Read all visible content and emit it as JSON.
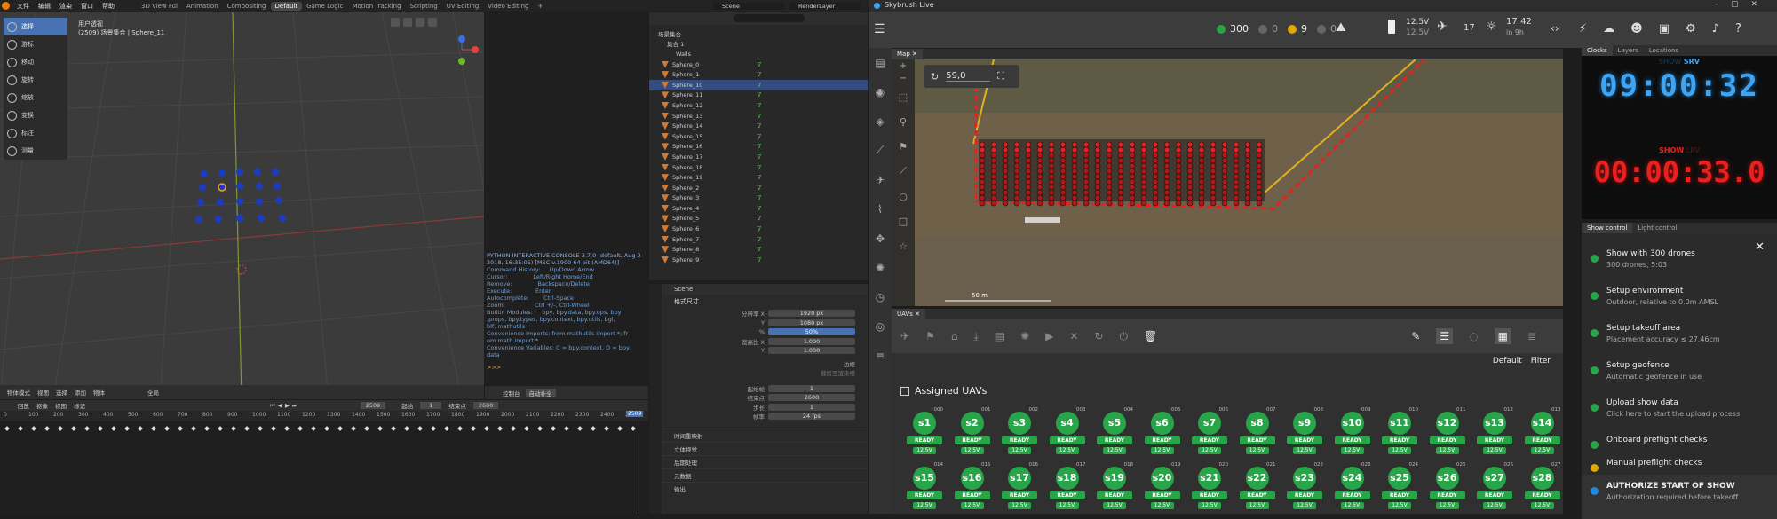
{
  "blender": {
    "menus": [
      "文件",
      "编辑",
      "渲染",
      "窗口",
      "帮助"
    ],
    "workspaces": [
      "3D View Ful",
      "Animation",
      "Compositing",
      "Default",
      "Game Logic",
      "Motion Tracking",
      "Scripting",
      "UV Editing",
      "Video Editing"
    ],
    "active_workspace": "Default",
    "scene_field": "Scene",
    "layer_field": "RenderLayer",
    "viewport": {
      "info_line1": "用户透视",
      "info_line2": "(2509) 场景集合 | Sphere_11"
    },
    "tools": [
      {
        "label": "选择",
        "icon": "cursor-icon"
      },
      {
        "label": "游标",
        "icon": "cursor-target-icon"
      },
      {
        "label": "移动",
        "icon": "move-icon"
      },
      {
        "label": "旋转",
        "icon": "rotate-icon"
      },
      {
        "label": "缩放",
        "icon": "scale-icon"
      },
      {
        "label": "变换",
        "icon": "transform-icon"
      },
      {
        "label": "标注",
        "icon": "annotate-icon"
      },
      {
        "label": "测量",
        "icon": "measure-icon"
      }
    ],
    "vp_footer": [
      "物体模式",
      "视图",
      "选择",
      "添加",
      "物体",
      "全局"
    ],
    "console": {
      "lines": [
        "PYTHON INTERACTIVE CONSOLE 3.7.0 (default, Aug 2",
        "2018, 16:35:05) [MSC v.1900 64 bit (AMD64)]",
        "",
        "Command History:     Up/Down Arrow",
        "Cursor:              Left/Right Home/End",
        "Remove:              Backspace/Delete",
        "Execute:             Enter",
        "Autocomplete:        Ctrl-Space",
        "Zoom:                Ctrl +/-, Ctrl-Wheel",
        "Builtin Modules:     bpy, bpy.data, bpy.ops, bpy",
        ".props, bpy.types, bpy.context, bpy.utils, bgl,",
        "blf, mathutils",
        "Convenience Imports: from mathutils import *; fr",
        "om math import *",
        "Convenience Variables: C = bpy.context, D = bpy.",
        "data"
      ],
      "prompt": ">>> ",
      "footer": [
        "控制台",
        "自动补全"
      ]
    },
    "outliner": {
      "scene_collection": "场景集合",
      "collection": "集合 1",
      "group": "Walls",
      "items": [
        "Sphere_0",
        "Sphere_1",
        "Sphere_10",
        "Sphere_11",
        "Sphere_12",
        "Sphere_13",
        "Sphere_14",
        "Sphere_15",
        "Sphere_16",
        "Sphere_17",
        "Sphere_18",
        "Sphere_19",
        "Sphere_2",
        "Sphere_3",
        "Sphere_4",
        "Sphere_5",
        "Sphere_6",
        "Sphere_7",
        "Sphere_8",
        "Sphere_9"
      ],
      "selected": "Sphere_10"
    },
    "props": {
      "scene": "Scene",
      "section": "格式尺寸",
      "rows": [
        {
          "label": "分辨率 X",
          "value": "1920 px"
        },
        {
          "label": "Y",
          "value": "1080 px"
        },
        {
          "label": "%",
          "value": "50%"
        },
        {
          "label": "宽高比 X",
          "value": "1.000"
        },
        {
          "label": "Y",
          "value": "1.000"
        }
      ],
      "border": "边框",
      "crop": "裁剪至渲染框",
      "frame_rows": [
        {
          "label": "起始帧",
          "value": "1"
        },
        {
          "label": "结束点",
          "value": "2600"
        },
        {
          "label": "步长",
          "value": "1"
        },
        {
          "label": "帧率",
          "value": "24 fps"
        }
      ],
      "panels": [
        "时间重映射",
        "立体视觉",
        "后期处理",
        "元数据",
        "输出"
      ]
    },
    "timeline": {
      "menus": [
        "回放",
        "抠像",
        "视图",
        "标记"
      ],
      "current_frame": "2509",
      "start_label": "起始",
      "start": "1",
      "end_label": "结束点",
      "end": "2600",
      "ticks": [
        "0",
        "100",
        "200",
        "300",
        "400",
        "500",
        "600",
        "700",
        "800",
        "900",
        "1000",
        "1100",
        "1200",
        "1300",
        "1400",
        "1500",
        "1600",
        "1700",
        "1800",
        "1900",
        "2000",
        "2100",
        "2200",
        "2300",
        "2400",
        "2500"
      ],
      "playhead": "2509"
    }
  },
  "skybrush": {
    "title": "Skybrush Live",
    "status": {
      "online": "300",
      "warning": "0",
      "error": "9",
      "other": "0",
      "voltage_max": "12.5V",
      "voltage_min": "12.5V",
      "gps": "17",
      "time": "17:42",
      "time_sub": "in 9h"
    },
    "map_tab": "Map",
    "map_rotation": "59,0",
    "scale_label": "50 m",
    "uavs_tab": "UAVs",
    "assigned_label": "Assigned UAVs",
    "sort": "Default",
    "filter": "Filter",
    "uavs": [
      {
        "n": "s1",
        "id": "000",
        "r": "READY",
        "b": "12.5V"
      },
      {
        "n": "s2",
        "id": "001",
        "r": "READY",
        "b": "12.5V"
      },
      {
        "n": "s3",
        "id": "002",
        "r": "READY",
        "b": "12.5V"
      },
      {
        "n": "s4",
        "id": "003",
        "r": "READY",
        "b": "12.5V"
      },
      {
        "n": "s5",
        "id": "004",
        "r": "READY",
        "b": "12.5V"
      },
      {
        "n": "s6",
        "id": "005",
        "r": "READY",
        "b": "12.5V"
      },
      {
        "n": "s7",
        "id": "006",
        "r": "READY",
        "b": "12.5V"
      },
      {
        "n": "s8",
        "id": "007",
        "r": "READY",
        "b": "12.5V"
      },
      {
        "n": "s9",
        "id": "008",
        "r": "READY",
        "b": "12.5V"
      },
      {
        "n": "s10",
        "id": "009",
        "r": "READY",
        "b": "12.5V"
      },
      {
        "n": "s11",
        "id": "010",
        "r": "READY",
        "b": "12.5V"
      },
      {
        "n": "s12",
        "id": "011",
        "r": "READY",
        "b": "12.5V"
      },
      {
        "n": "s13",
        "id": "012",
        "r": "READY",
        "b": "12.5V"
      },
      {
        "n": "s14",
        "id": "013",
        "r": "READY",
        "b": "12.5V"
      },
      {
        "n": "s15",
        "id": "014",
        "r": "READY",
        "b": "12.5V"
      },
      {
        "n": "s16",
        "id": "015",
        "r": "READY",
        "b": "12.5V"
      },
      {
        "n": "s17",
        "id": "016",
        "r": "READY",
        "b": "12.5V"
      },
      {
        "n": "s18",
        "id": "017",
        "r": "READY",
        "b": "12.5V"
      },
      {
        "n": "s19",
        "id": "018",
        "r": "READY",
        "b": "12.5V"
      },
      {
        "n": "s20",
        "id": "019",
        "r": "READY",
        "b": "12.5V"
      },
      {
        "n": "s21",
        "id": "020",
        "r": "READY",
        "b": "12.5V"
      },
      {
        "n": "s22",
        "id": "021",
        "r": "READY",
        "b": "12.5V"
      },
      {
        "n": "s23",
        "id": "022",
        "r": "READY",
        "b": "12.5V"
      },
      {
        "n": "s24",
        "id": "023",
        "r": "READY",
        "b": "12.5V"
      },
      {
        "n": "s25",
        "id": "024",
        "r": "READY",
        "b": "12.5V"
      },
      {
        "n": "s26",
        "id": "025",
        "r": "READY",
        "b": "12.5V"
      },
      {
        "n": "s27",
        "id": "026",
        "r": "READY",
        "b": "12.5V"
      },
      {
        "n": "s28",
        "id": "027",
        "r": "READY",
        "b": "12.5V"
      }
    ],
    "clock_tabs": [
      "Clocks",
      "Layers",
      "Locations"
    ],
    "clock1": {
      "label_a": "SHOW",
      "label_b": "SRV",
      "time": "09:00:32"
    },
    "clock2": {
      "label_a": "SHOW",
      "label_b": "LRV",
      "time": "00:00:33.0"
    },
    "control_tabs": [
      "Show control",
      "Light control"
    ],
    "steps": [
      {
        "t": "Show with 300 drones",
        "s": "300 drones, 5:03",
        "dot": "#27a548"
      },
      {
        "t": "Setup environment",
        "s": "Outdoor, relative to 0.0m AMSL",
        "dot": "#27a548"
      },
      {
        "t": "Setup takeoff area",
        "s": "Placement accuracy ≤ 27.46cm",
        "dot": "#27a548"
      },
      {
        "t": "Setup geofence",
        "s": "Automatic geofence in use",
        "dot": "#27a548"
      },
      {
        "t": "Upload show data",
        "s": "Click here to start the upload process",
        "dot": "#27a548"
      },
      {
        "t": "Onboard preflight checks",
        "s": "",
        "dot": "#27a548"
      },
      {
        "t": "Manual preflight checks",
        "s": "",
        "dot": "#e0a800"
      },
      {
        "t": "AUTHORIZE START OF SHOW",
        "s": "Authorization required before takeoff",
        "dot": "#1e88e5"
      }
    ]
  }
}
